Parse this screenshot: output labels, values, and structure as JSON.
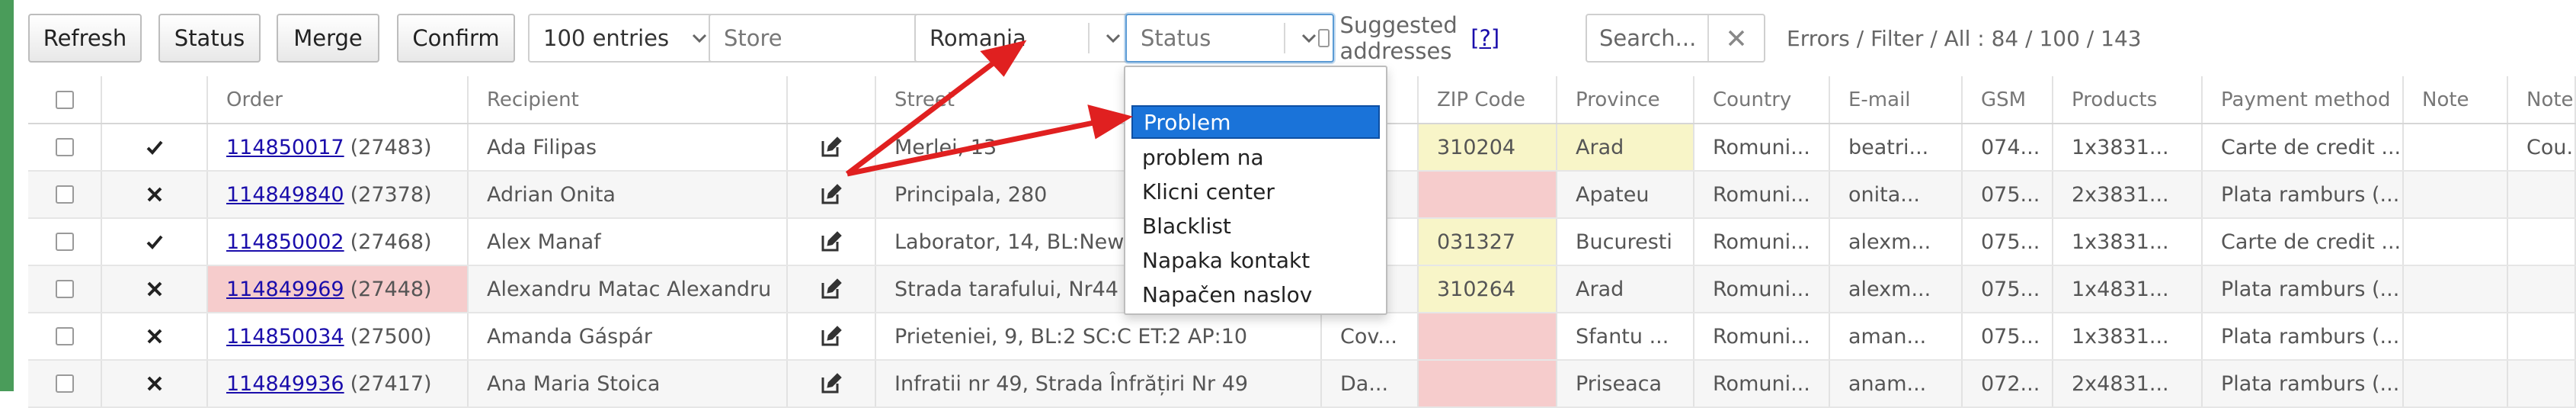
{
  "toolbar": {
    "refresh": "Refresh",
    "status": "Status",
    "merge": "Merge",
    "confirm": "Confirm",
    "entries": "100 entries",
    "store_placeholder": "Store",
    "country": "Romania",
    "status_filter_placeholder": "Status",
    "suggested": "Suggested addresses",
    "help": "[?]",
    "search_placeholder": "Search...",
    "stats": "Errors / Filter / All : 84 / 100 / 143"
  },
  "columns": [
    "Order",
    "Recipient",
    "Street",
    "ZIP Code",
    "Province",
    "Country",
    "E-mail",
    "GSM",
    "Products",
    "Payment method",
    "Note",
    "Note"
  ],
  "rows": [
    {
      "status": "check",
      "order": "114850017",
      "ref": "(27483)",
      "recipient": "Ada Filipas",
      "street": "Merlei, 13",
      "city": "",
      "zip": "310204",
      "province": "Arad",
      "country": "Romuni...",
      "email": "beatri...",
      "gsm": "074...",
      "products": "1x3831...",
      "payment": "Carte de credit ...",
      "note": "",
      "note2": "Cou..."
    },
    {
      "status": "cross",
      "order": "114849840",
      "ref": "(27378)",
      "recipient": "Adrian Onita",
      "street": "Principala, 280",
      "city": "",
      "zip": "",
      "province": "Apateu",
      "country": "Romuni...",
      "email": "onita...",
      "gsm": "075...",
      "products": "2x3831...",
      "payment": "Plata ramburs (...",
      "note": "",
      "note2": ""
    },
    {
      "status": "check",
      "order": "114850002",
      "ref": "(27468)",
      "recipient": "Alex Manaf",
      "street": "Laborator, 14, BL:New city re",
      "city": "",
      "zip": "031327",
      "province": "Bucuresti",
      "country": "Romuni...",
      "email": "alexm...",
      "gsm": "075...",
      "products": "1x3831...",
      "payment": "Carte de credit ...",
      "note": "",
      "note2": ""
    },
    {
      "status": "cross",
      "order": "114849969",
      "ref": "(27448)",
      "recipient": "Alexandru Matac Alexandru",
      "street": "Strada tarafului, Nr44 ap4",
      "city": "",
      "zip": "310264",
      "province": "Arad",
      "country": "Romuni...",
      "email": "alexm...",
      "gsm": "075...",
      "products": "1x4831...",
      "payment": "Plata ramburs (...",
      "note": "",
      "note2": ""
    },
    {
      "status": "cross",
      "order": "114850034",
      "ref": "(27500)",
      "recipient": "Amanda Gáspár",
      "street": "Prieteniei, 9, BL:2 SC:C ET:2 AP:10",
      "city": "Cov...",
      "zip": "",
      "province": "Sfantu ...",
      "country": "Romuni...",
      "email": "aman...",
      "gsm": "075...",
      "products": "1x3831...",
      "payment": "Plata ramburs (...",
      "note": "",
      "note2": ""
    },
    {
      "status": "cross",
      "order": "114849936",
      "ref": "(27417)",
      "recipient": "Ana Maria Stoica",
      "street": "Infratii nr 49, Strada Înfrățiri Nr 49",
      "city": "Da...",
      "zip": "",
      "province": "Priseaca",
      "country": "Romuni...",
      "email": "anam...",
      "gsm": "072...",
      "products": "2x4831...",
      "payment": "Plata ramburs (...",
      "note": "",
      "note2": ""
    }
  ],
  "status_dropdown": {
    "options": [
      "Problem",
      "problem na",
      "Klicni center",
      "Blacklist",
      "Napaka kontakt",
      "Napačen naslov"
    ],
    "highlighted": "Problem"
  },
  "colors": {
    "accent": "#1a73d9",
    "error": "#f6cccc",
    "ok": "#f8f5c8",
    "annotation": "#e02020",
    "link": "#1a0dab"
  }
}
